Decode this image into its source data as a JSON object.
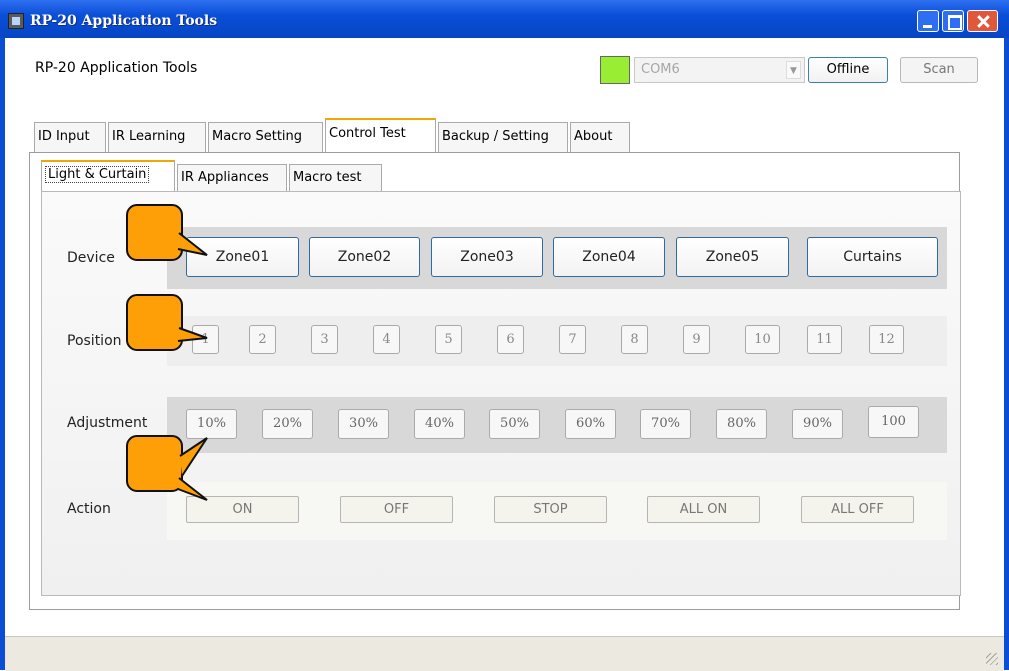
{
  "window": {
    "title": "RP-20 Application Tools"
  },
  "header": {
    "app_label": "RP-20 Application Tools",
    "status_color": "#99ee33",
    "com_port": "COM6",
    "offline_label": "Offline",
    "scan_label": "Scan"
  },
  "main_tabs": [
    "ID Input",
    "IR Learning",
    "Macro Setting",
    "Control Test",
    "Backup / Setting",
    "About"
  ],
  "active_main_tab": "Control Test",
  "sub_tabs": [
    "Light & Curtain",
    "IR Appliances",
    "Macro test"
  ],
  "active_sub_tab": "Light & Curtain",
  "rows": {
    "device": {
      "label": "Device",
      "buttons": [
        "Zone01",
        "Zone02",
        "Zone03",
        "Zone04",
        "Zone05",
        "Curtains"
      ]
    },
    "position": {
      "label": "Position",
      "buttons": [
        "1",
        "2",
        "3",
        "4",
        "5",
        "6",
        "7",
        "8",
        "9",
        "10",
        "11",
        "12"
      ]
    },
    "adjustment": {
      "label": "Adjustment",
      "buttons": [
        "10%",
        "20%",
        "30%",
        "40%",
        "50%",
        "60%",
        "70%",
        "80%",
        "90%",
        "100"
      ]
    },
    "action": {
      "label": "Action",
      "buttons": [
        "ON",
        "OFF",
        "STOP",
        "ALL ON",
        "ALL OFF"
      ]
    }
  },
  "colors": {
    "accent": "#f0a800",
    "callout": "#ff9f08",
    "titlebar": "#0a4fd8"
  }
}
